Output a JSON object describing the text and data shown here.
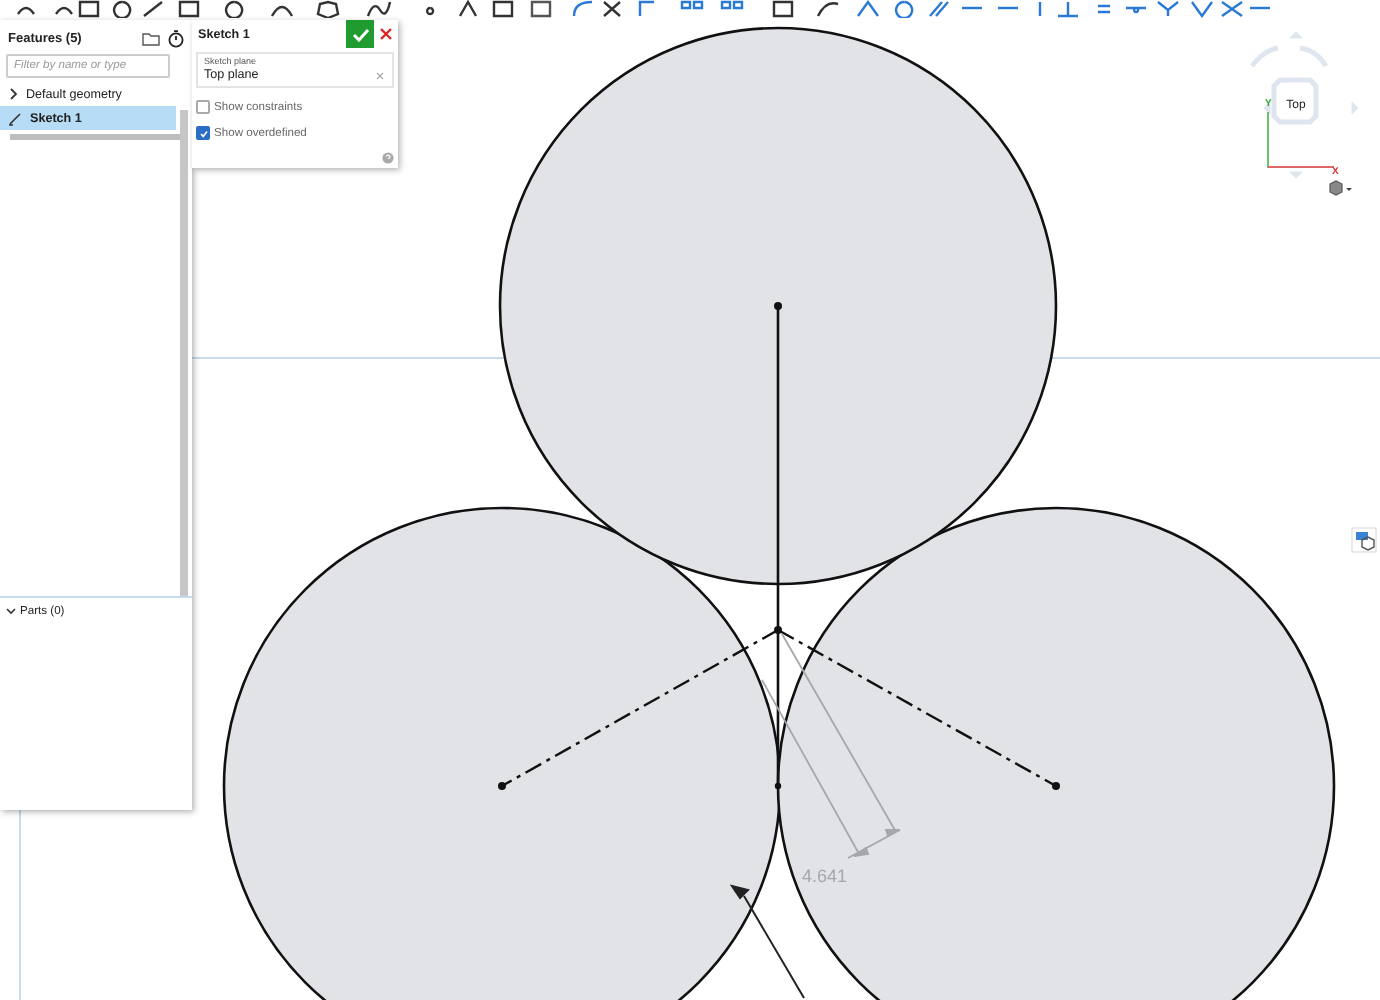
{
  "features_panel": {
    "title": "Features (5)",
    "filter": {
      "placeholder": "Filter by name or type"
    },
    "items": [
      {
        "label": "Default geometry",
        "kind": "group",
        "expanded": false,
        "selected": false
      },
      {
        "label": "Sketch 1",
        "kind": "sketch",
        "selected": true
      }
    ],
    "parts": {
      "label": "Parts (0)",
      "expanded": true
    }
  },
  "sketch_dialog": {
    "title": "Sketch 1",
    "plane": {
      "label": "Sketch plane",
      "value": "Top plane"
    },
    "options": [
      {
        "label": "Show constraints",
        "checked": false
      },
      {
        "label": "Show overdefined",
        "checked": true
      }
    ]
  },
  "view_cube": {
    "face": "Top",
    "y_axis": "Y",
    "x_axis": "X"
  },
  "sketch": {
    "dimension": "4.641"
  }
}
